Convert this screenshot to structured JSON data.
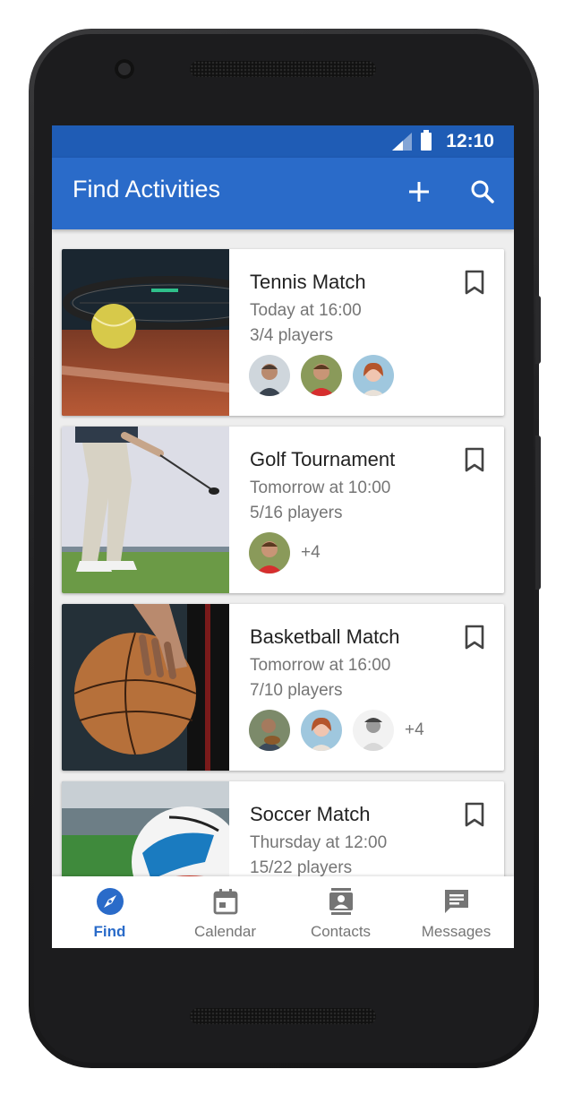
{
  "status": {
    "time": "12:10"
  },
  "appbar": {
    "title": "Find Activities",
    "add_icon": "plus-icon",
    "search_icon": "search-icon"
  },
  "colors": {
    "primary": "#2a6bc9",
    "status_bar": "#1f5cb5",
    "text_secondary": "#757575"
  },
  "activities": [
    {
      "title": "Tennis Match",
      "time": "Today at 16:00",
      "players": "3/4 players",
      "extra": ""
    },
    {
      "title": "Golf Tournament",
      "time": "Tomorrow at 10:00",
      "players": "5/16 players",
      "extra": "+4"
    },
    {
      "title": "Basketball Match",
      "time": "Tomorrow at 16:00",
      "players": "7/10 players",
      "extra": "+4"
    },
    {
      "title": "Soccer Match",
      "time": "Thursday at 12:00",
      "players": "15/22 players",
      "extra": ""
    }
  ],
  "nav": [
    {
      "label": "Find",
      "icon": "compass-icon",
      "active": true
    },
    {
      "label": "Calendar",
      "icon": "calendar-icon",
      "active": false
    },
    {
      "label": "Contacts",
      "icon": "contacts-icon",
      "active": false
    },
    {
      "label": "Messages",
      "icon": "message-icon",
      "active": false
    }
  ]
}
